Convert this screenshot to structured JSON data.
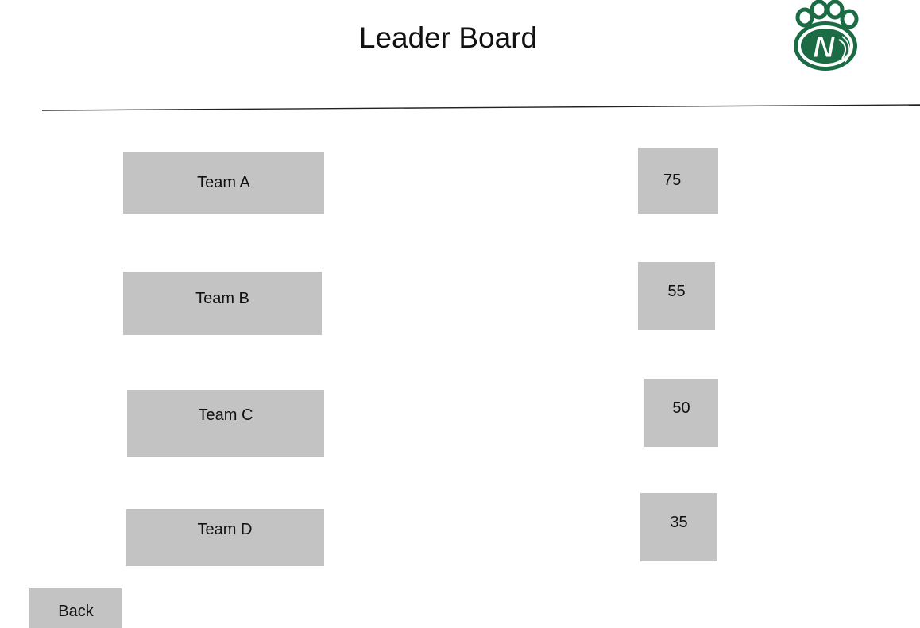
{
  "page": {
    "title": "Leader Board"
  },
  "logo": {
    "icon": "paw-print-n-logo",
    "letter": "N",
    "colors": {
      "green": "#1b6b45",
      "white": "#ffffff"
    }
  },
  "teams": [
    {
      "name": "Team A",
      "score": "75"
    },
    {
      "name": "Team B",
      "score": "55"
    },
    {
      "name": "Team C",
      "score": "50"
    },
    {
      "name": "Team D",
      "score": "35"
    }
  ],
  "back_button": {
    "label": "Back"
  },
  "colors": {
    "box_fill": "#c3c3c3",
    "divider": "#222222"
  }
}
